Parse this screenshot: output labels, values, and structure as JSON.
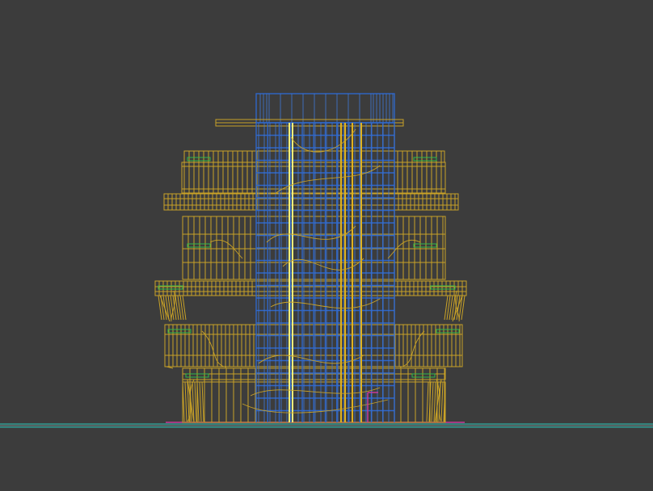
{
  "viewport": {
    "background": "#3c3c3c",
    "render_mode": "wireframe",
    "colors": {
      "structure": "#c9a227",
      "core_grid": "#2f66c8",
      "highlight": "#e6e07a",
      "accent_green": "#2fb84a",
      "ground_cyan": "#29c4b8",
      "ground_magenta": "#c83a9a"
    }
  }
}
